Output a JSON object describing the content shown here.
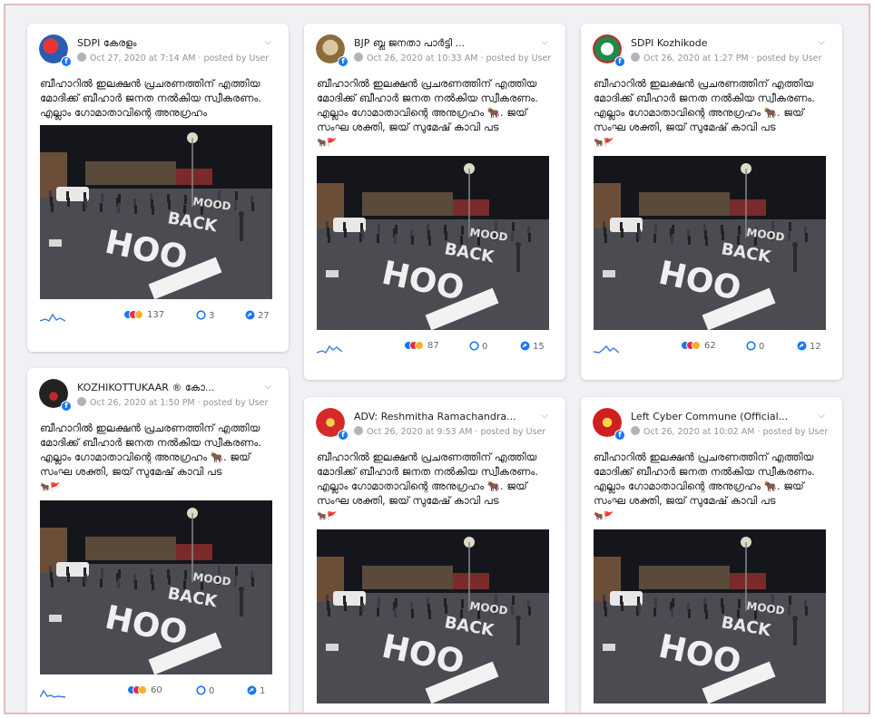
{
  "badge_letter": "f",
  "photo_caption_lines": [
    "HOO",
    "MOOD",
    "BACK"
  ],
  "posts": [
    {
      "name": "SDPI കേരളം",
      "date": "Oct 27, 2020 at 7:14 AM",
      "posted_by": "posted by User",
      "text": "ബീഹാറിൽ ഇലക്ഷൻ പ്രചരണത്തിന് എത്തിയ മോദിക്ക് ബീഹാർ ജനത നൽകിയ സ്വീകരണം. എല്ലാം ഗോമാതാവിന്റെ അനുഗ്രഹം",
      "emoji": "",
      "reactions": "137",
      "comments": "3",
      "shares": "27",
      "avatar_color": "#2a5db0"
    },
    {
      "name": "BJP ബ്ലൂ ജനതാ പാർട്ടി ...",
      "date": "Oct 26, 2020 at 10:33 AM",
      "posted_by": "posted by User",
      "text": "ബീഹാറിൽ ഇലക്ഷൻ പ്രചരണത്തിന് എത്തിയ മോദിക്ക് ബീഹാർ ജനത നൽകിയ സ്വീകരണം. എല്ലാം ഗോമാതാവിന്റെ അനുഗ്രഹം 🐂. ജയ് സംഘ ശക്തി, ജയ് സുമേഷ് കാവി പട",
      "emoji": "🐂🚩",
      "reactions": "87",
      "comments": "0",
      "shares": "15",
      "avatar_color": "#8a6b3a"
    },
    {
      "name": "SDPI Kozhikode",
      "date": "Oct 26, 2020 at 1:27 PM",
      "posted_by": "posted by User",
      "text": "ബീഹാറിൽ ഇലക്ഷൻ പ്രചരണത്തിന് എത്തിയ മോദിക്ക് ബീഹാർ ജനത നൽകിയ സ്വീകരണം. എല്ലാം ഗോമാതാവിന്റെ അനുഗ്രഹം 🐂. ജയ് സംഘ ശക്തി, ജയ് സുമേഷ് കാവി പട",
      "emoji": "🐂🚩",
      "reactions": "62",
      "comments": "0",
      "shares": "12",
      "avatar_color": "#1f8a4c"
    },
    {
      "name": "KOZHIKOTTUKAAR ® കോ...",
      "date": "Oct 26, 2020 at 1:50 PM",
      "posted_by": "posted by User",
      "text": "ബീഹാറിൽ ഇലക്ഷൻ പ്രചരണത്തിന് എത്തിയ മോദിക്ക് ബീഹാർ ജനത നൽകിയ സ്വീകരണം. എല്ലാം ഗോമാതാവിന്റെ അനുഗ്രഹം 🐂. ജയ് സംഘ ശക്തി, ജയ് സുമേഷ് കാവി പട",
      "emoji": "🐂🚩",
      "reactions": "60",
      "comments": "0",
      "shares": "1",
      "avatar_color": "#222222"
    },
    {
      "name": "ADV: Reshmitha Ramachandra...",
      "date": "Oct 26, 2020 at 9:53 AM",
      "posted_by": "posted by User",
      "text": "ബീഹാറിൽ ഇലക്ഷൻ പ്രചരണത്തിന് എത്തിയ മോദിക്ക് ബീഹാർ ജനത നൽകിയ സ്വീകരണം. എല്ലാം ഗോമാതാവിന്റെ അനുഗ്രഹം 🐂. ജയ് സംഘ ശക്തി, ജയ് സുമേഷ് കാവി പട",
      "emoji": "🐂🚩",
      "reactions": "",
      "comments": "",
      "shares": "",
      "avatar_color": "#d62a2a"
    },
    {
      "name": "Left Cyber Commune (Official...",
      "date": "Oct 26, 2020 at 10:02 AM",
      "posted_by": "posted by User",
      "text": "ബീഹാറിൽ ഇലക്ഷൻ പ്രചരണത്തിന് എത്തിയ മോദിക്ക് ബീഹാർ ജനത നൽകിയ സ്വീകരണം. എല്ലാം ഗോമാതാവിന്റെ അനുഗ്രഹം 🐂. ജയ് സംഘ ശക്തി, ജയ് സുമേഷ് കാവി പട",
      "emoji": "🐂🚩",
      "reactions": "",
      "comments": "",
      "shares": "",
      "avatar_color": "#d11f1f"
    }
  ]
}
